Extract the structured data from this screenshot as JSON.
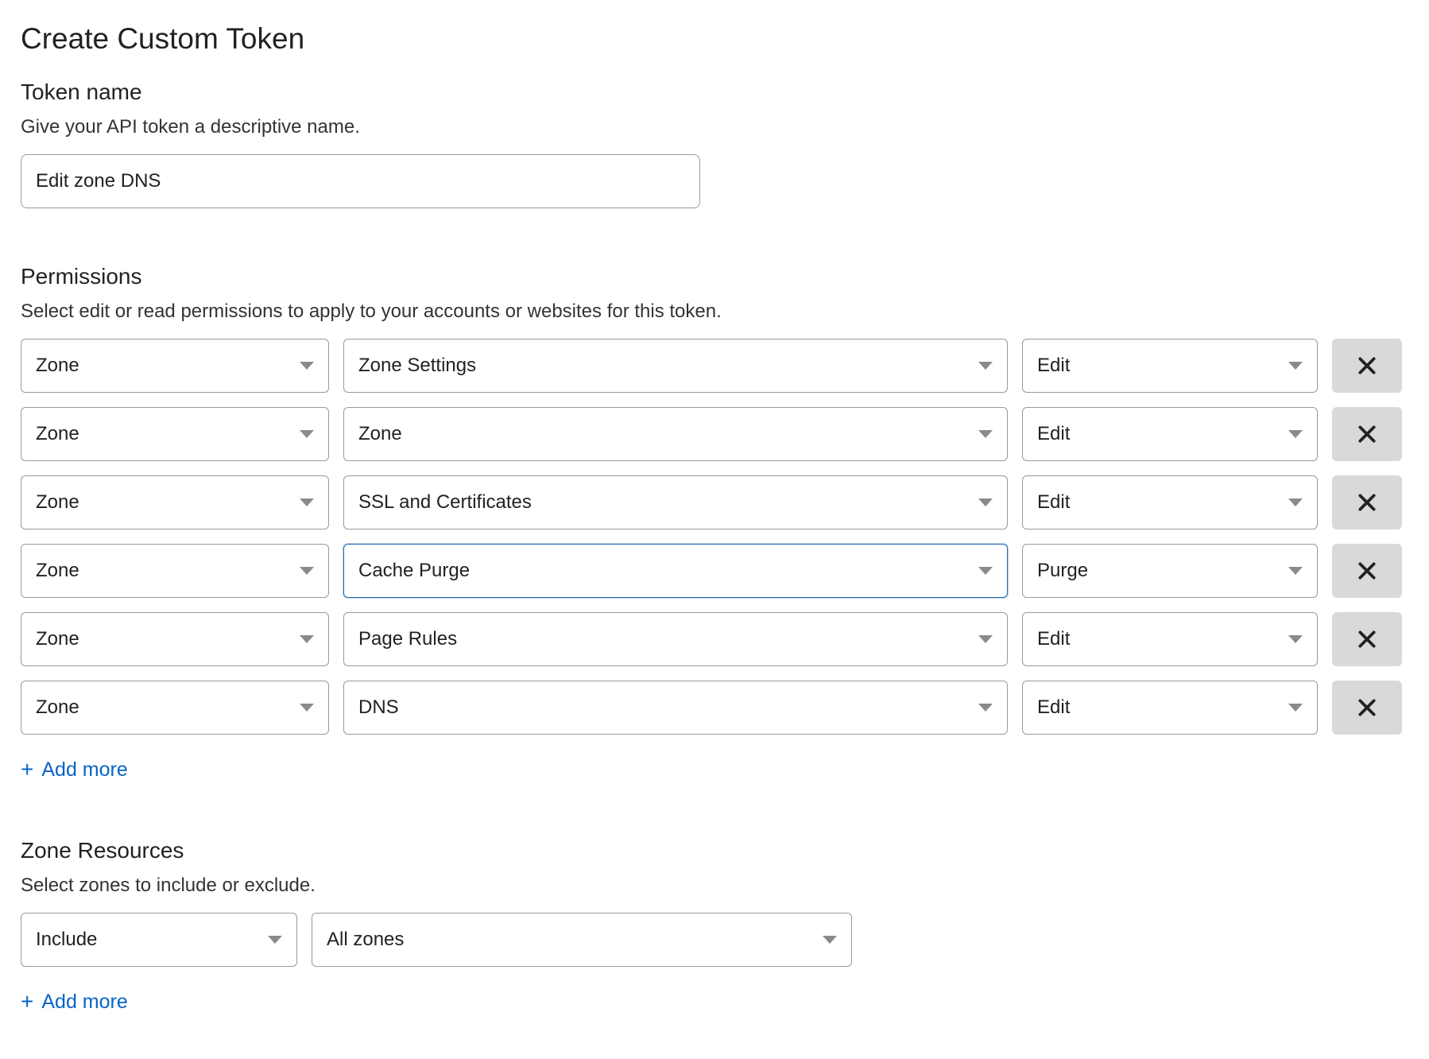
{
  "page_title": "Create Custom Token",
  "token_name": {
    "label": "Token name",
    "help": "Give your API token a descriptive name.",
    "value": "Edit zone DNS"
  },
  "permissions": {
    "heading": "Permissions",
    "help": "Select edit or read permissions to apply to your accounts or websites for this token.",
    "rows": [
      {
        "scope": "Zone",
        "resource": "Zone Settings",
        "action": "Edit",
        "focused": false
      },
      {
        "scope": "Zone",
        "resource": "Zone",
        "action": "Edit",
        "focused": false
      },
      {
        "scope": "Zone",
        "resource": "SSL and Certificates",
        "action": "Edit",
        "focused": false
      },
      {
        "scope": "Zone",
        "resource": "Cache Purge",
        "action": "Purge",
        "focused": true
      },
      {
        "scope": "Zone",
        "resource": "Page Rules",
        "action": "Edit",
        "focused": false
      },
      {
        "scope": "Zone",
        "resource": "DNS",
        "action": "Edit",
        "focused": false
      }
    ],
    "add_more_label": "Add more"
  },
  "zone_resources": {
    "heading": "Zone Resources",
    "help": "Select zones to include or exclude.",
    "rows": [
      {
        "mode": "Include",
        "scope": "All zones"
      }
    ],
    "add_more_label": "Add more"
  }
}
